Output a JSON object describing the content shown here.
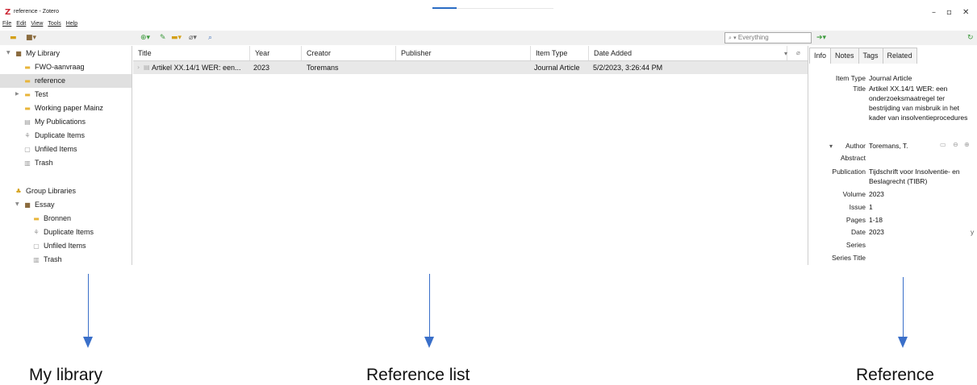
{
  "window": {
    "title": "reference - Zotero",
    "logo_letter": "Z",
    "minimize": "–",
    "maximize": "▫",
    "close": "✕"
  },
  "menu": [
    "File",
    "Edit",
    "View",
    "Tools",
    "Help"
  ],
  "toolbar": {
    "search_placeholder": "Everything",
    "search_icon": "search-icon"
  },
  "sidebar": {
    "items": [
      {
        "label": "My Library",
        "icon": "library-icon"
      },
      {
        "label": "FWO-aanvraag",
        "icon": "folder-icon"
      },
      {
        "label": "reference",
        "icon": "folder-icon"
      },
      {
        "label": "Test",
        "icon": "folder-icon"
      },
      {
        "label": "Working paper Mainz",
        "icon": "folder-icon"
      },
      {
        "label": "My Publications",
        "icon": "publications-icon"
      },
      {
        "label": "Duplicate Items",
        "icon": "duplicate-icon"
      },
      {
        "label": "Unfiled Items",
        "icon": "unfiled-icon"
      },
      {
        "label": "Trash",
        "icon": "trash-icon"
      },
      {
        "label": "Group Libraries",
        "icon": "group-icon"
      },
      {
        "label": "Essay",
        "icon": "library-icon"
      },
      {
        "label": "Bronnen",
        "icon": "folder-icon"
      },
      {
        "label": "Duplicate Items",
        "icon": "duplicate-icon"
      },
      {
        "label": "Unfiled Items",
        "icon": "unfiled-icon"
      },
      {
        "label": "Trash",
        "icon": "trash-icon"
      }
    ]
  },
  "items_table": {
    "columns": [
      "Title",
      "Year",
      "Creator",
      "Publisher",
      "Item Type",
      "Date Added"
    ],
    "rows": [
      {
        "title": "Artikel XX.14/1 WER: een...",
        "year": "2023",
        "creator": "Toremans",
        "publisher": "",
        "item_type": "Journal Article",
        "date_added": "5/2/2023, 3:26:44 PM"
      }
    ]
  },
  "item_pane": {
    "tabs": [
      "Info",
      "Notes",
      "Tags",
      "Related"
    ],
    "active_tab": "Info",
    "fields": {
      "item_type": {
        "label": "Item Type",
        "value": "Journal Article"
      },
      "title": {
        "label": "Title",
        "value": "Artikel XX.14/1 WER: een onderzoeksmaatregel ter bestrijding van misbruik in het kader van insolventieprocedures"
      },
      "author": {
        "label": "Author",
        "value": "Toremans, T."
      },
      "abstract": {
        "label": "Abstract",
        "value": ""
      },
      "publication": {
        "label": "Publication",
        "value": "Tijdschrift voor Insolventie- en Beslagrecht (TIBR)"
      },
      "volume": {
        "label": "Volume",
        "value": "2023"
      },
      "issue": {
        "label": "Issue",
        "value": "1"
      },
      "pages": {
        "label": "Pages",
        "value": "1-18"
      },
      "date": {
        "label": "Date",
        "value": "2023"
      },
      "date_hint": "y",
      "series": {
        "label": "Series",
        "value": ""
      },
      "series_title": {
        "label": "Series Title",
        "value": ""
      }
    }
  },
  "captions": {
    "left": "My library",
    "middle": "Reference list",
    "right": "Reference"
  },
  "colors": {
    "arrow": "#3a6fc9",
    "selection": "#e0e0e0",
    "folder": "#e8b53a"
  }
}
